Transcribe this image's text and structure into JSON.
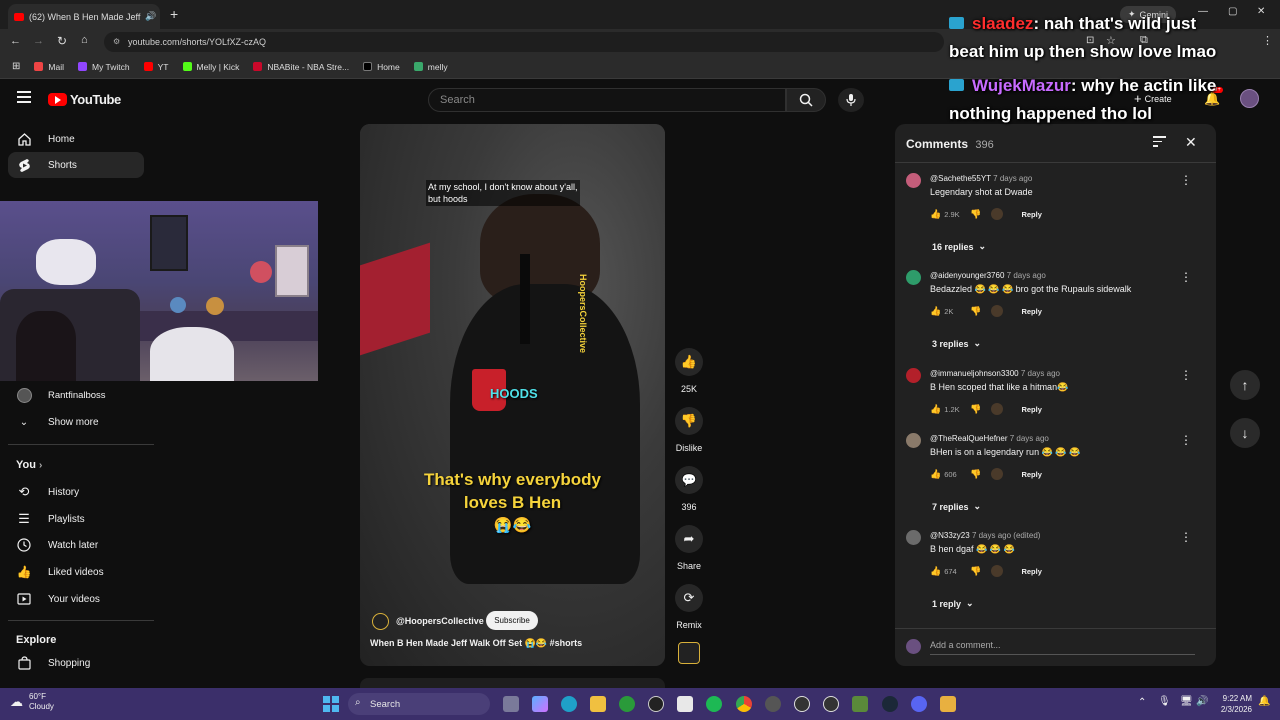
{
  "browser": {
    "tab_title": "(62) When B Hen Made Jeff",
    "url": "youtube.com/shorts/YOLfXZ-czAQ",
    "bookmarks": [
      "Mail",
      "My Twitch",
      "YT",
      "Melly | Kick",
      "NBABite - NBA Stre...",
      "Home",
      "melly"
    ],
    "gemini_label": "Gemini"
  },
  "youtube": {
    "logo_text": "YouTube",
    "search_placeholder": "Search",
    "create_label": "Create",
    "notification_count": "9+"
  },
  "sidebar": {
    "home": "Home",
    "shorts": "Shorts",
    "subscription_channel": "Rantfinalboss",
    "show_more": "Show more",
    "you_title": "You",
    "you_chevron": "›",
    "you_items": [
      "History",
      "Playlists",
      "Watch later",
      "Liked videos",
      "Your videos"
    ],
    "explore_title": "Explore",
    "explore_items": [
      "Shopping"
    ]
  },
  "video": {
    "caption_top_line1": "At my school, I don't know about y'all,",
    "caption_top_line2": "but hoods",
    "vertical_watermark": "HoopersCollective",
    "sticker_text": "HOODS",
    "caption_main_line1": "That's why everybody",
    "caption_main_line2": "loves B Hen",
    "caption_main_emoji": "😭😂",
    "channel_handle": "@HoopersCollective",
    "subscribe_label": "Subscribe",
    "title": "When B Hen Made Jeff Walk Off Set 😭😂 #shorts"
  },
  "actions": {
    "like_count": "25K",
    "dislike_label": "Dislike",
    "comment_count": "396",
    "share_label": "Share",
    "remix_label": "Remix"
  },
  "comments": {
    "header_title": "Comments",
    "header_count": "396",
    "add_placeholder": "Add a comment...",
    "reply_label": "Reply",
    "items": [
      {
        "author": "@Sachethe55YT",
        "time": "7 days ago",
        "text": "Legendary shot at Dwade",
        "likes": "2.9K",
        "replies": "16 replies",
        "avatar_color": "#c45d7a"
      },
      {
        "author": "@aidenyounger3760",
        "time": "7 days ago",
        "text": "Bedazzled 😂 😂 😂 bro got the Rupauls sidewalk",
        "likes": "2K",
        "replies": "3 replies",
        "avatar_color": "#2e9c6a"
      },
      {
        "author": "@immanueljohnson3300",
        "time": "7 days ago",
        "text": "B Hen scoped that like a hitman😂",
        "likes": "1.2K",
        "replies": "",
        "avatar_color": "#b3202a"
      },
      {
        "author": "@TheRealQueHefner",
        "time": "7 days ago",
        "text": "BHen is on a legendary run 😂 😂 😂",
        "likes": "606",
        "replies": "7 replies",
        "avatar_color": "#8a7a6a"
      },
      {
        "author": "@N33zy23",
        "time": "7 days ago (edited)",
        "text": "B hen dgaf 😂 😂 😂",
        "likes": "674",
        "replies": "1 reply",
        "avatar_color": "#6b6b6b"
      }
    ]
  },
  "overlay_chat": [
    {
      "user": "slaadez",
      "user_color": "#ff2d2d",
      "message": ": nah that's wild just",
      "message2": "beat him up then show love lmao"
    },
    {
      "user": "WujekMazur",
      "user_color": "#c86bff",
      "message": ": why he actin like",
      "message2": "nothing happened tho lol"
    }
  ],
  "taskbar": {
    "weather_temp": "60°F",
    "weather_desc": "Cloudy",
    "search_label": "Search",
    "time": "9:22 AM",
    "date": "2/3/2026"
  },
  "colors": {
    "yt_red": "#ff0000",
    "caption_yellow": "#f5d33b",
    "taskbar_bg": "#3b2f6a"
  }
}
